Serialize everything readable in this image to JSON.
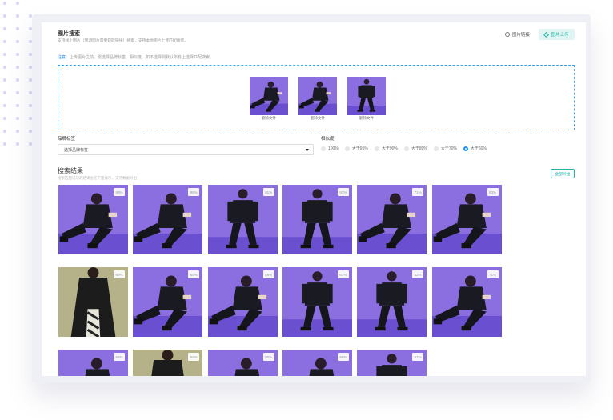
{
  "header": {
    "title": "图片搜索",
    "subtitle": "支持线上图片（图源图片需要获取链接）搜索，支持本地图片上传匹配搜索。",
    "link_label": "图片链接",
    "upload_label": "图片上传"
  },
  "note": {
    "prefix": "注意",
    "text": "：上传图片之前，需选择品牌标签、相似度，如不选择则默认所有上选择匹配搜索。"
  },
  "dropzone": {
    "thumbnails": [
      {
        "caption": "删除文件",
        "pose": "sit"
      },
      {
        "caption": "删除文件",
        "pose": "sit"
      },
      {
        "caption": "删除文件",
        "pose": "stand"
      }
    ]
  },
  "filters": {
    "brand_label": "品牌标签",
    "brand_placeholder": "选择品牌标签",
    "similarity_label": "相似度",
    "options": [
      "100%",
      "大于95%",
      "大于90%",
      "大于80%",
      "大于70%",
      "大于60%"
    ],
    "selected_index": 5
  },
  "results": {
    "title": "搜索结果",
    "subtitle": "搜索匹配成功的结果会在下面展示，支持数据导出",
    "export_label": "全部导出",
    "items": [
      {
        "similarity": "99%",
        "pose": "sit",
        "bg": "purple"
      },
      {
        "similarity": "98%",
        "pose": "sit",
        "bg": "purple"
      },
      {
        "similarity": "91%",
        "pose": "stand",
        "bg": "purple"
      },
      {
        "similarity": "93%",
        "pose": "stand",
        "bg": "purple"
      },
      {
        "similarity": "71%",
        "pose": "sit",
        "bg": "purple"
      },
      {
        "similarity": "63%",
        "pose": "sit",
        "bg": "purple"
      },
      {
        "similarity": "60%",
        "pose": "coat",
        "bg": "beige"
      },
      {
        "similarity": "60%",
        "pose": "sit",
        "bg": "purple"
      },
      {
        "similarity": "88%",
        "pose": "sit",
        "bg": "purple"
      },
      {
        "similarity": "67%",
        "pose": "stand",
        "bg": "purple"
      },
      {
        "similarity": "62%",
        "pose": "stand",
        "bg": "purple"
      },
      {
        "similarity": "71%",
        "pose": "sit",
        "bg": "purple"
      },
      {
        "similarity": "69%",
        "pose": "sit",
        "bg": "purple"
      },
      {
        "similarity": "60%",
        "pose": "coat",
        "bg": "beige"
      },
      {
        "similarity": "90%",
        "pose": "sit",
        "bg": "purple"
      },
      {
        "similarity": "88%",
        "pose": "sit",
        "bg": "purple"
      },
      {
        "similarity": "67%",
        "pose": "stand",
        "bg": "purple"
      }
    ]
  },
  "colors": {
    "accent": "#1fb5a4",
    "link": "#1890ff",
    "purple_bg": "#8b6fe0",
    "beige_bg": "#b5b28a"
  }
}
